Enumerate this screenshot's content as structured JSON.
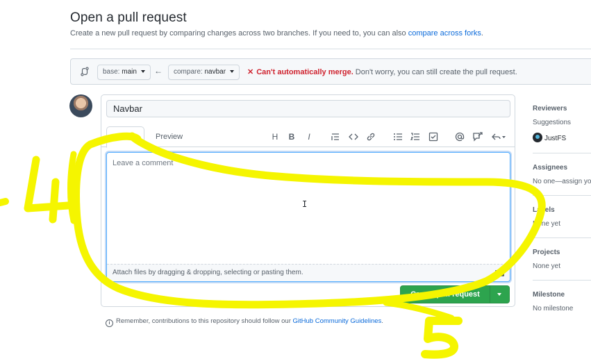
{
  "page": {
    "title": "Open a pull request",
    "subtitle_prefix": "Create a new pull request by comparing changes across two branches. If you need to, you can also",
    "subtitle_link": "compare across forks",
    "subtitle_suffix": "."
  },
  "range": {
    "base_prefix": "base:",
    "base_branch": "main",
    "compare_prefix": "compare:",
    "compare_branch": "navbar",
    "merge_x": "✕",
    "merge_status": "Can't automatically merge.",
    "merge_note": "Don't worry, you can still create the pull request."
  },
  "composer": {
    "title_value": "Navbar",
    "tab_write": "Write",
    "tab_preview": "Preview",
    "toolbar": {
      "heading": "H",
      "bold": "B",
      "italic": "I"
    },
    "comment_placeholder": "Leave a comment",
    "attach_text": "Attach files by dragging & dropping, selecting or pasting them.",
    "md_badge": "M↓"
  },
  "actions": {
    "create_label": "Create pull request"
  },
  "reminder": {
    "prefix": "Remember, contributions to this repository should follow our",
    "link": "GitHub Community Guidelines",
    "suffix": "."
  },
  "sidebar": {
    "reviewers_head": "Reviewers",
    "reviewers_sub": "Suggestions",
    "reviewer_name": "JustFS",
    "assignees_head": "Assignees",
    "assignees_text": "No one—assign you",
    "labels_head": "Labels",
    "labels_text": "None yet",
    "projects_head": "Projects",
    "projects_text": "None yet",
    "milestone_head": "Milestone",
    "milestone_text": "No milestone"
  },
  "annotations": {
    "number_left": "4",
    "number_bottom": "5",
    "highlight_color": "#f5f500"
  }
}
